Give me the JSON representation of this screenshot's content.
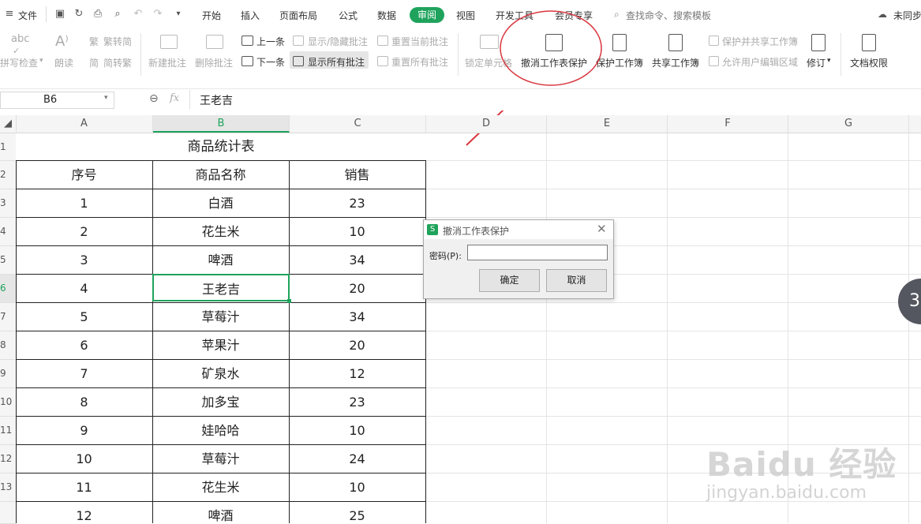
{
  "menubar": {
    "file": "文件",
    "tabs": [
      "开始",
      "插入",
      "页面布局",
      "公式",
      "数据",
      "审阅",
      "视图",
      "开发工具",
      "会员专享"
    ],
    "active_tab": "审阅",
    "search_placeholder": "查找命令、搜索模板",
    "user": "未同步"
  },
  "ribbon": {
    "spellcheck": "拼写检查",
    "read_aloud": "朗读",
    "trad": "繁转简",
    "simp": "简转繁",
    "new_comment": "新建批注",
    "delete_comment": "删除批注",
    "prev": "上一条",
    "next": "下一条",
    "toggle_comment": "显示/隐藏批注",
    "show_all": "显示所有批注",
    "reset_current": "重置当前批注",
    "reset_all": "重置所有批注",
    "lock_cell": "锁定单元格",
    "unprotect_sheet": "撤消工作表保护",
    "protect_book": "保护工作簿",
    "share_book": "共享工作簿",
    "protect_share": "保护并共享工作簿",
    "allow_edit": "允许用户编辑区域",
    "revise": "修订",
    "doc_rights": "文档权限"
  },
  "formula_bar": {
    "name_box": "B6",
    "fx": "fx",
    "value": "王老吉"
  },
  "columns": [
    "A",
    "B",
    "C",
    "D",
    "E",
    "F",
    "G"
  ],
  "rows": [
    "1",
    "2",
    "3",
    "4",
    "5",
    "6",
    "7",
    "8",
    "9",
    "10",
    "11",
    "12",
    "13"
  ],
  "sheet": {
    "title": "商品统计表",
    "headers": [
      "序号",
      "商品名称",
      "销售"
    ],
    "data": [
      [
        "1",
        "白酒",
        "23"
      ],
      [
        "2",
        "花生米",
        "10"
      ],
      [
        "3",
        "啤酒",
        "34"
      ],
      [
        "4",
        "王老吉",
        "20"
      ],
      [
        "5",
        "草莓汁",
        "34"
      ],
      [
        "6",
        "苹果汁",
        "20"
      ],
      [
        "7",
        "矿泉水",
        "12"
      ],
      [
        "8",
        "加多宝",
        "23"
      ],
      [
        "9",
        "娃哈哈",
        "10"
      ],
      [
        "10",
        "草莓汁",
        "24"
      ],
      [
        "11",
        "花生米",
        "10"
      ],
      [
        "12",
        "啤酒",
        "25"
      ]
    ]
  },
  "dialog": {
    "title": "撤消工作表保护",
    "password_label": "密码(P):",
    "ok": "确定",
    "cancel": "取消"
  },
  "side_badge": "3",
  "watermark": {
    "brand": "Baidu 经验",
    "url": "jingyan.baidu.com"
  },
  "colors": {
    "accent": "#1fa35c",
    "annotation": "#d9363e"
  }
}
